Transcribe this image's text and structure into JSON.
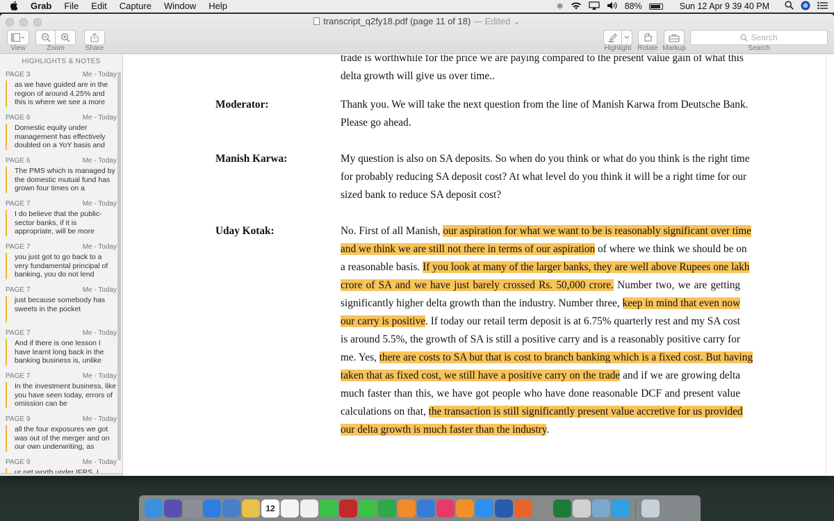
{
  "menubar": {
    "apple": "",
    "app_name": "Grab",
    "menus": [
      "File",
      "Edit",
      "Capture",
      "Window",
      "Help"
    ],
    "battery": "88%",
    "clock": "Sun 12 Apr  9 39 40 PM"
  },
  "window": {
    "title": "transcript_q2fy18.pdf (page 11 of 18)",
    "title_status": "— Edited ⌄",
    "toolbar": {
      "view_label": "View",
      "zoom_label": "Zoom",
      "share_label": "Share",
      "highlight_label": "Highlight",
      "rotate_label": "Rotate",
      "markup_label": "Markup",
      "search_placeholder": "Search",
      "search_label": "Search"
    }
  },
  "sidebar": {
    "heading": "HIGHLIGHTS & NOTES",
    "notes": [
      {
        "page": "PAGE 3",
        "author": "Me - Today",
        "text": " as we have guided are in the region of around 4.25% and this is where we see a more"
      },
      {
        "page": "PAGE 6",
        "author": "Me - Today",
        "text": "Domestic equity under management has effectively doubled on a YoY basis and"
      },
      {
        "page": "PAGE 6",
        "author": "Me - Today",
        "text": "The PMS which is managed by the domestic mutual fund has grown four times on a"
      },
      {
        "page": "PAGE 7",
        "author": "Me - Today",
        "text": " I do believe that the public-sector banks, if it is appropriate, will be more"
      },
      {
        "page": "PAGE 7",
        "author": "Me - Today",
        "text": " you just got to go back to a very fundamental principal of banking, you do not lend"
      },
      {
        "page": "PAGE 7",
        "author": "Me - Today",
        "text": "just because somebody has sweets in the pocket"
      },
      {
        "page": "PAGE 7",
        "author": "Me - Today",
        "text": "And if there is one lesson I have learnt long back in the banking business is, unlike"
      },
      {
        "page": "PAGE 7",
        "author": "Me - Today",
        "text": "In the investment business, like you have seen today, errors of omission can be"
      },
      {
        "page": "PAGE 9",
        "author": "Me - Today",
        "text": "all the four exposures we got was out of the merger and on our own underwriting, as"
      },
      {
        "page": "PAGE 9",
        "author": "Me - Today",
        "text": "ur net worth under IFRS, I"
      }
    ]
  },
  "document": {
    "top_lines": [
      "trade is worthwhile for the price we are paying compared to the present value gain of what this",
      "delta growth will give us over time.."
    ],
    "blocks": [
      {
        "speaker": "Moderator:",
        "lines": [
          [
            {
              "t": "Thank you. We will take the next question from the line of Manish Karwa from Deutsche Bank.",
              "h": false
            }
          ],
          [
            {
              "t": "Please go ahead.",
              "h": false
            }
          ]
        ]
      },
      {
        "speaker": "Manish Karwa:",
        "lines": [
          [
            {
              "t": "My question is also on SA deposits. So when do you think or what do you think is the right time",
              "h": false
            }
          ],
          [
            {
              "t": "for probably reducing SA deposit cost? At what level do you think it will be a right time for our",
              "h": false
            }
          ],
          [
            {
              "t": "sized bank to reduce SA deposit cost?",
              "h": false
            }
          ]
        ]
      },
      {
        "speaker": "Uday Kotak:",
        "lines": [
          [
            {
              "t": "No. First of all Manish, ",
              "h": false
            },
            {
              "t": "our aspiration for what we want to be is reasonably significant over time",
              "h": true
            }
          ],
          [
            {
              "t": "and we think we are still not there in terms of our aspiration",
              "h": true
            },
            {
              "t": " of where we think we should be on",
              "h": false
            }
          ],
          [
            {
              "t": "a reasonable basis. ",
              "h": false
            },
            {
              "t": "If you look at many of the larger banks, they are well above Rupees one lakh",
              "h": true
            }
          ],
          [
            {
              "t": "crore of SA and we have just barely crossed Rs. 50,000 crore.",
              "h": true
            },
            {
              "t": " Number two, we are getting",
              "h": false
            }
          ],
          [
            {
              "t": "significantly higher delta growth than the industry. Number three, ",
              "h": false
            },
            {
              "t": "keep in mind that even now",
              "h": true
            }
          ],
          [
            {
              "t": "our carry is positive",
              "h": true
            },
            {
              "t": ". If today our retail term deposit is at 6.75% quarterly rest and my SA cost",
              "h": false
            }
          ],
          [
            {
              "t": "is around 5.5%, the growth of SA is still a positive carry and is a reasonably positive carry for",
              "h": false
            }
          ],
          [
            {
              "t": "me. Yes, ",
              "h": false
            },
            {
              "t": "there are costs to SA but that is cost to branch banking which is a fixed cost. But having",
              "h": true
            }
          ],
          [
            {
              "t": "taken that as fixed cost, we still have a positive carry on the trade",
              "h": true
            },
            {
              "t": " and if we are growing delta",
              "h": false
            }
          ],
          [
            {
              "t": "much faster than this, we have got people who have done reasonable DCF and present value",
              "h": false
            }
          ],
          [
            {
              "t": "calculations on that, ",
              "h": false
            },
            {
              "t": "the transaction is still significantly present value accretive for us provided",
              "h": true
            }
          ],
          [
            {
              "t": "our delta growth is much faster than the industry",
              "h": true
            },
            {
              "t": ".",
              "h": false
            }
          ]
        ]
      }
    ]
  },
  "dock": {
    "icons": [
      "finder-icon",
      "siri-icon",
      "launchpad-icon",
      "safari-icon",
      "preview-icon",
      "notes-icon",
      "calendar-icon",
      "reminders-icon",
      "photos-icon",
      "messages-icon",
      "photo-booth-icon",
      "facetime-icon",
      "numbers-icon",
      "pages-icon",
      "keynote-icon",
      "itunes-icon",
      "ibooks-icon",
      "app-store-icon",
      "word-icon",
      "firefox-icon",
      "system-preferences-icon",
      "excel-icon",
      "screenshot-icon",
      "directory-utility-icon",
      "telegram-icon",
      "trash-icon"
    ],
    "calendar_day": "12",
    "colors": [
      "#3a8fe0",
      "#5a4fb0",
      "#8a8f98",
      "#2f7de0",
      "#4a7fc8",
      "#e8c04a",
      "#ffffff",
      "#f4f4f4",
      "#f0f0f0",
      "#3ec046",
      "#c02a2a",
      "#3ec046",
      "#2ea84a",
      "#f08a2a",
      "#3b7bd8",
      "#e83a6a",
      "#f0902a",
      "#2f8ef0",
      "#2a5bb0",
      "#e8652a",
      "#8a8a8a",
      "#1f7a3a",
      "#d0d0d0",
      "#7aa8d0",
      "#2fa0e0",
      "#c8d0d8"
    ]
  }
}
